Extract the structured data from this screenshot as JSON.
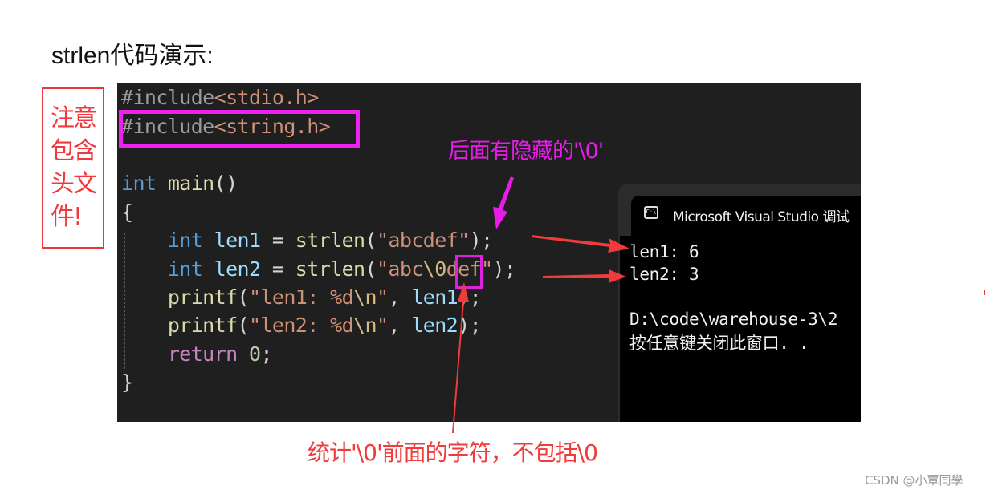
{
  "heading": "strlen代码演示:",
  "note": "注意包含头文件!",
  "code": {
    "lines": [
      {
        "pp": "#include",
        "inc": "<stdio.h>"
      },
      {
        "pp": "#include",
        "inc": "<string.h>"
      },
      {
        "kw": "int",
        "fn": "main",
        "rest": "()"
      },
      {
        "brace": "{"
      },
      {
        "kw": "int",
        "var": "len1",
        "eq": " = ",
        "fn": "strlen",
        "open": "(",
        "str": "\"abcdef\"",
        "close": ");"
      },
      {
        "kw": "int",
        "var": "len2",
        "eq": " = ",
        "fn": "strlen",
        "open": "(",
        "str_a": "\"abc",
        "esc": "\\0",
        "str_b": "def\"",
        "close": ");"
      },
      {
        "fn": "printf",
        "open": "(",
        "str_a": "\"len1: %d",
        "esc": "\\n",
        "str_b": "\"",
        "comma": ", ",
        "var": "len1",
        "close": ");"
      },
      {
        "fn": "printf",
        "open": "(",
        "str_a": "\"len2: %d",
        "esc": "\\n",
        "str_b": "\"",
        "comma": ", ",
        "var": "len2",
        "close": ");"
      },
      {
        "ret": "return",
        "num": "0",
        "semi": ";"
      },
      {
        "brace": "}"
      }
    ]
  },
  "terminal": {
    "title": "Microsoft Visual Studio 调试",
    "icon": "console-icon",
    "icon_text": "C:\\",
    "output": [
      "len1: 6",
      "len2: 3",
      "",
      "D:\\code\\warehouse-3\\2",
      "按任意键关闭此窗口. ."
    ]
  },
  "annotations": {
    "hidden_terminator": "后面有隐藏的'\\0'",
    "counts_before": "统计'\\0'前面的字符，不包括\\0"
  },
  "colors": {
    "magenta": "#e81ce8",
    "red": "#ef3b3b",
    "code_bg": "#1f1f1f"
  },
  "watermark": "CSDN @小覃同學"
}
